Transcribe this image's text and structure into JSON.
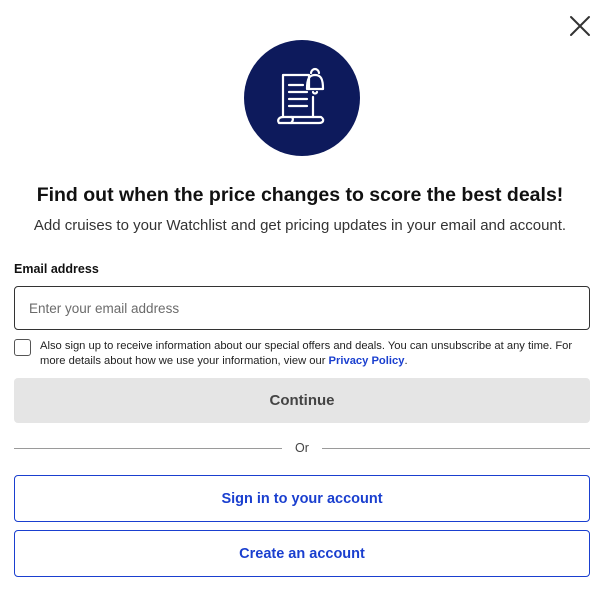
{
  "dialog": {
    "hero_icon": "watchlist-document-bell-icon",
    "title": "Find out when the price changes to score the best deals!",
    "subtitle": "Add cruises to your Watchlist and get pricing updates in your email and account."
  },
  "form": {
    "email_label": "Email address",
    "email_placeholder": "Enter your email address",
    "email_value": "",
    "optin_checked": false,
    "optin_text": "Also sign up to receive information about our special offers and deals. You can unsubscribe at any time. For more details about how we use your information, view our",
    "privacy_link": "Privacy Policy",
    "optin_suffix": ".",
    "continue_label": "Continue"
  },
  "divider": {
    "label": "Or"
  },
  "actions": {
    "signin_label": "Sign in to your account",
    "create_label": "Create an account"
  },
  "colors": {
    "brand_navy": "#0d1a5c",
    "link_blue": "#1a3fcf",
    "disabled_gray": "#e5e5e5"
  }
}
